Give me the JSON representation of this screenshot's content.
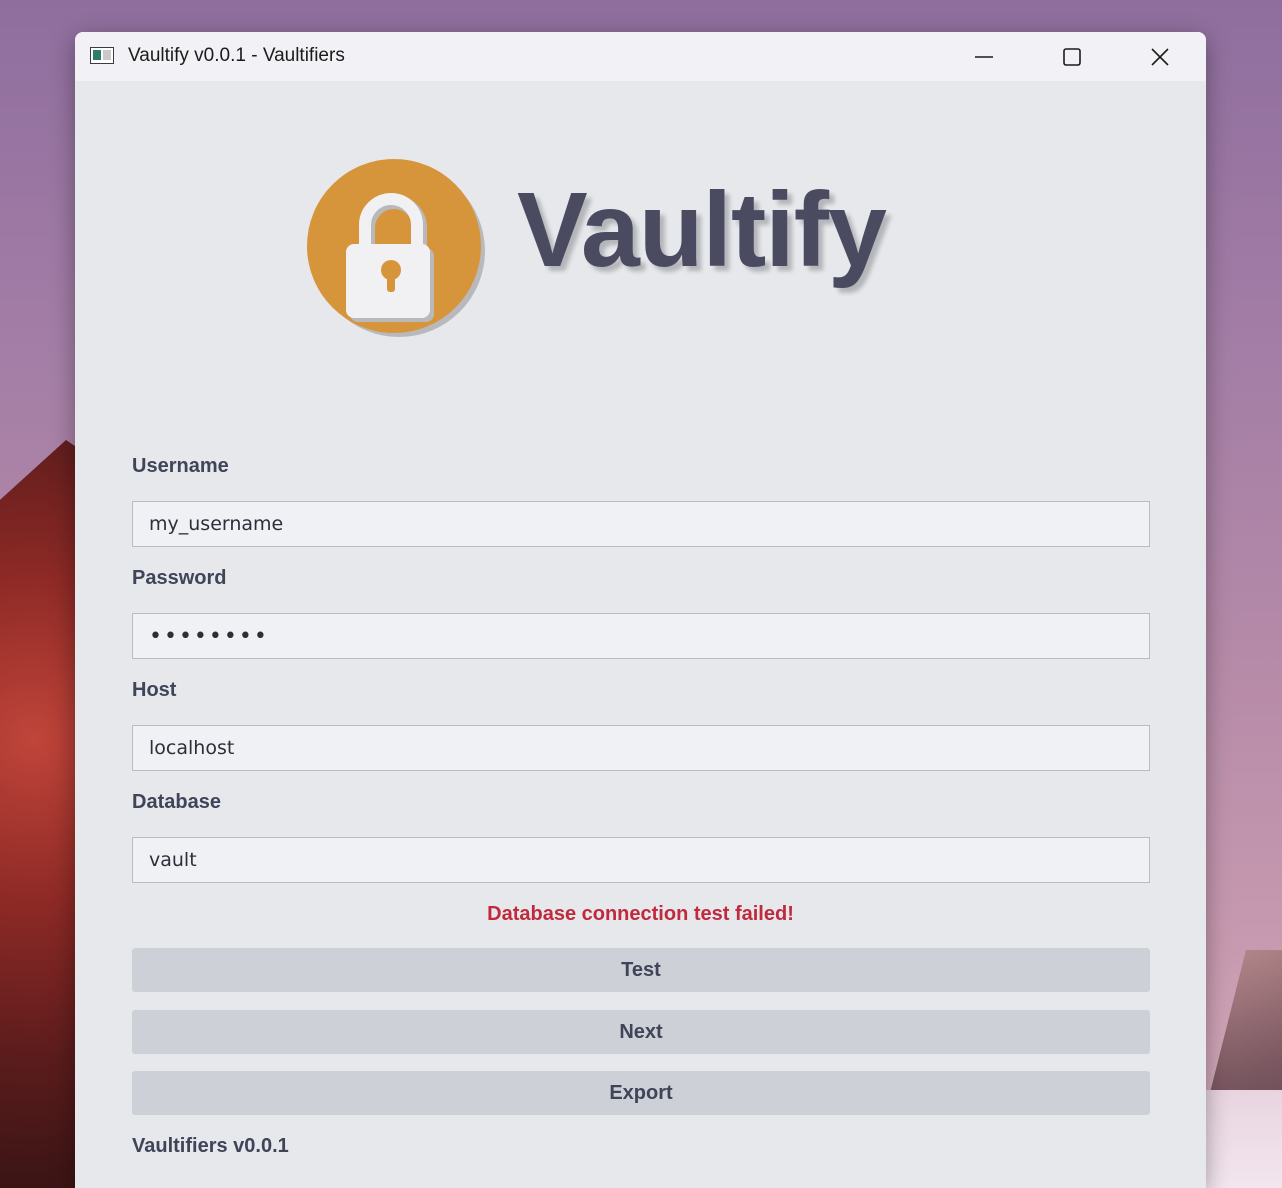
{
  "window": {
    "title": "Vaultify v0.0.1 - Vaultifiers",
    "controls": [
      "minimize-icon",
      "maximize-icon",
      "close-icon"
    ]
  },
  "brand": {
    "name": "Vaultify",
    "logo_icon": "padlock-icon",
    "logo_color": "#d6953a"
  },
  "form": {
    "username": {
      "label": "Username",
      "value": "my_username"
    },
    "password": {
      "label": "Password",
      "value": "password"
    },
    "host": {
      "label": "Host",
      "value": "localhost"
    },
    "database": {
      "label": "Database",
      "value": "vault"
    }
  },
  "status": {
    "error": "Database connection test failed!",
    "error_color": "#c12a3c"
  },
  "buttons": {
    "test": "Test",
    "next": "Next",
    "export": "Export"
  },
  "footer": {
    "text": "Vaultifiers v0.0.1"
  }
}
